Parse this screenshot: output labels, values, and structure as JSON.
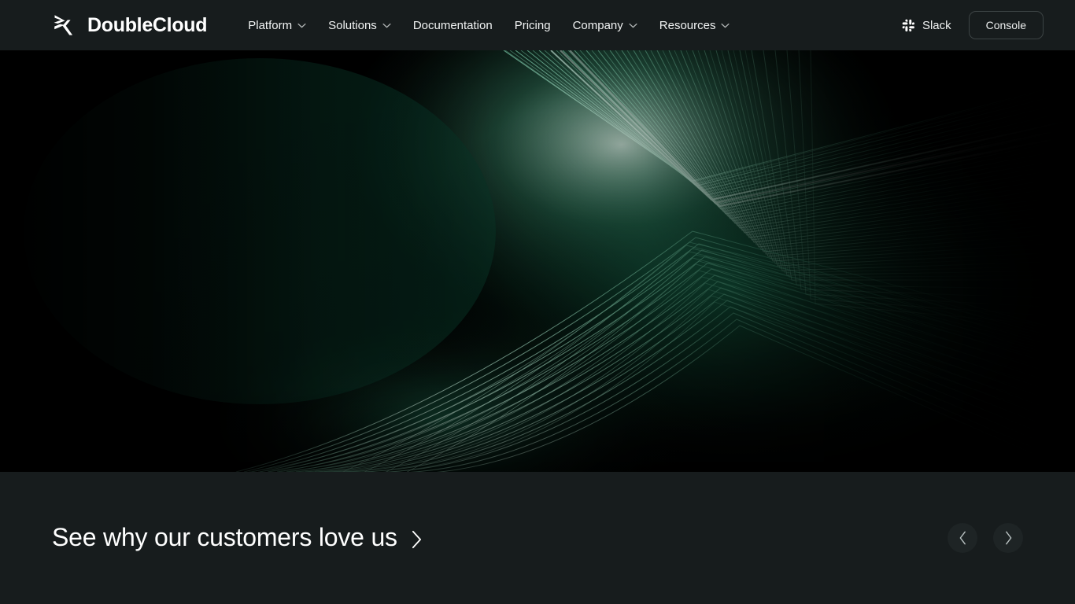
{
  "brand": {
    "name": "DoubleCloud",
    "logo_icon": "doublecloud-chevrons-logo"
  },
  "nav": {
    "items": [
      {
        "label": "Platform",
        "has_dropdown": true,
        "icon": "chevron-down-icon"
      },
      {
        "label": "Solutions",
        "has_dropdown": true,
        "icon": "chevron-down-icon"
      },
      {
        "label": "Documentation",
        "has_dropdown": false,
        "icon": ""
      },
      {
        "label": "Pricing",
        "has_dropdown": false,
        "icon": ""
      },
      {
        "label": "Company",
        "has_dropdown": true,
        "icon": "chevron-down-icon"
      },
      {
        "label": "Resources",
        "has_dropdown": true,
        "icon": "chevron-down-icon"
      }
    ]
  },
  "header_right": {
    "slack_label": "Slack",
    "slack_icon": "slack-icon",
    "console_label": "Console"
  },
  "hero": {
    "art_description": "abstract green line-art chevron",
    "background_color": "#000000",
    "glow_color": "#e8f5ee",
    "accent_color": "#2f9b74",
    "deep_color": "#05努2a1f"
  },
  "customers": {
    "title": "See why our customers love us",
    "title_caret_icon": "chevron-right-icon",
    "prev_label": "Previous",
    "prev_icon": "chevron-left-icon",
    "next_label": "Next",
    "next_icon": "chevron-right-icon"
  },
  "colors": {
    "surface": "#171c1d",
    "hero_bg": "#000000",
    "text_primary": "#ffffff",
    "text_secondary": "#f2f4f4",
    "border": "#3c4344",
    "button_bg": "#1e2425",
    "accent_green": "#2f9b74"
  }
}
